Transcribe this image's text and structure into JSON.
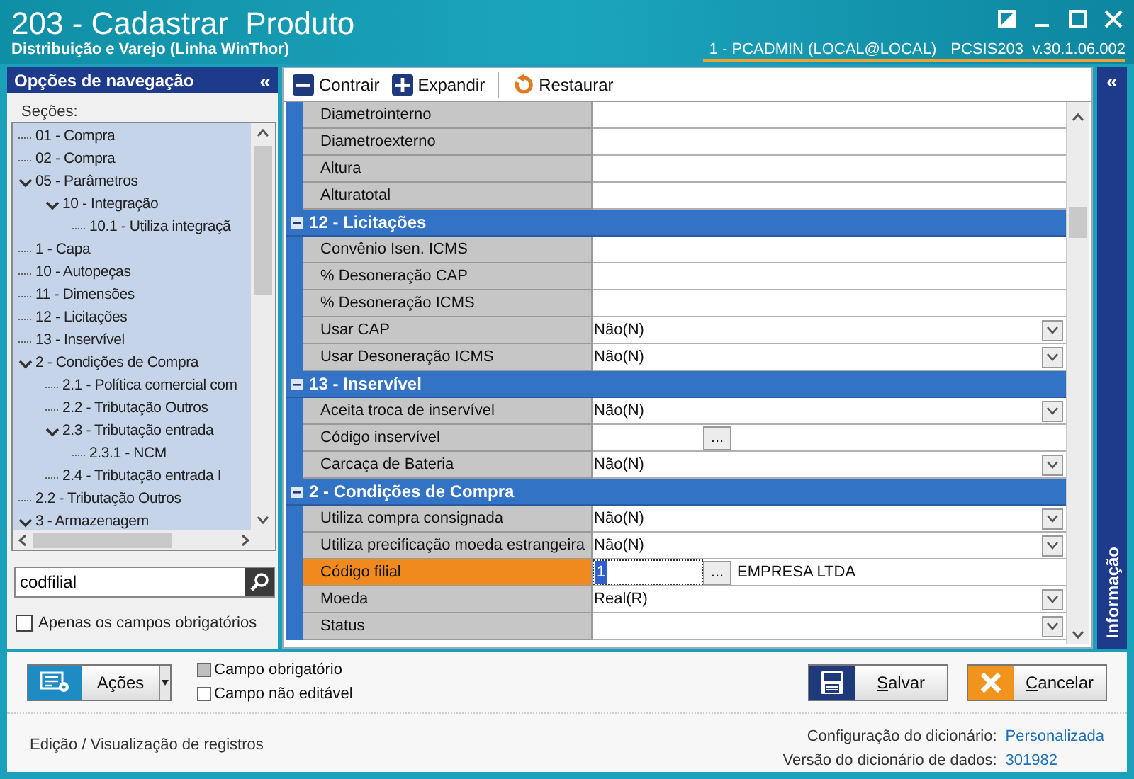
{
  "window": {
    "title": "203 - Cadastrar  Produto",
    "subtitle": "Distribuição e Varejo (Linha WinThor)",
    "user": "1 - PCADMIN (LOCAL@LOCAL)",
    "version": "PCSIS203  v.30.1.06.002"
  },
  "navigation": {
    "title": "Opções de navegação",
    "collapse": "«",
    "sections_label": "Seções:",
    "tree": [
      {
        "label": "01 - Compra"
      },
      {
        "label": "02 - Compra"
      },
      {
        "label": "05 - Parâmetros",
        "expanded": true,
        "children": [
          {
            "label": "10 - Integração",
            "expanded": true,
            "children": [
              {
                "label": "10.1 - Utiliza integraçã"
              }
            ]
          }
        ]
      },
      {
        "label": "1 - Capa"
      },
      {
        "label": "10 - Autopeças"
      },
      {
        "label": "11 - Dimensões"
      },
      {
        "label": "12 - Licitações"
      },
      {
        "label": "13 - Inservível"
      },
      {
        "label": "2 - Condições de Compra",
        "expanded": true,
        "children": [
          {
            "label": "2.1 - Política comercial com"
          },
          {
            "label": "2.2 - Tributação Outros"
          },
          {
            "label": "2.3 - Tributação entrada",
            "expanded": true,
            "children": [
              {
                "label": "2.3.1 - NCM"
              }
            ]
          },
          {
            "label": "2.4 - Tributação entrada I"
          }
        ]
      },
      {
        "label": "2.2 - Tributação Outros"
      },
      {
        "label": "3 - Armazenagem",
        "expanded": true
      }
    ],
    "search": {
      "value": "codfilial"
    },
    "only_required": {
      "label": "Apenas os campos obrigatórios",
      "checked": false
    }
  },
  "toolbar": [
    {
      "kind": "collapse",
      "label": "Contrair"
    },
    {
      "kind": "expand",
      "label": "Expandir"
    },
    {
      "kind": "restore",
      "label": "Restaurar"
    }
  ],
  "grid": {
    "rows": [
      {
        "kind": "text",
        "label": "Diametrointerno",
        "selected": false
      },
      {
        "kind": "text",
        "label": "Diametroexterno",
        "selected": false
      },
      {
        "kind": "text",
        "label": "Altura",
        "selected": false
      },
      {
        "kind": "text",
        "label": "Alturatotal",
        "selected": false
      },
      {
        "kind": "header",
        "label": "12 - Licitações",
        "expanded": true
      },
      {
        "kind": "text",
        "label": "Convênio Isen. ICMS",
        "selected": false
      },
      {
        "kind": "text",
        "label": "% Desoneração CAP",
        "selected": false
      },
      {
        "kind": "text",
        "label": "% Desoneração ICMS",
        "selected": false
      },
      {
        "kind": "dropdown",
        "label": "Usar CAP",
        "value": "Não(N)",
        "selected": false
      },
      {
        "kind": "dropdown",
        "label": "Usar Desoneração ICMS",
        "value": "Não(N)",
        "selected": false
      },
      {
        "kind": "header",
        "label": "13 - Inservível",
        "expanded": true
      },
      {
        "kind": "dropdown",
        "label": "Aceita troca de inservível",
        "value": "Não(N)",
        "selected": false
      },
      {
        "kind": "lookup",
        "label": "Código inservível",
        "browse_label": "...",
        "selected": false
      },
      {
        "kind": "dropdown",
        "label": "Carcaça de Bateria",
        "value": "Não(N)",
        "selected": false
      },
      {
        "kind": "header",
        "label": "2 - Condições de Compra",
        "expanded": true
      },
      {
        "kind": "dropdown",
        "label": "Utiliza compra consignada",
        "value": "Não(N)",
        "selected": false
      },
      {
        "kind": "dropdown",
        "label": "Utiliza precificação moeda estrangeira",
        "value": "Não(N)",
        "selected": false
      },
      {
        "kind": "lookup",
        "label": "Código filial",
        "value": "1",
        "browse_label": "...",
        "description": "EMPRESA LTDA",
        "selected": true
      },
      {
        "kind": "dropdown",
        "label": "Moeda",
        "value": "Real(R)",
        "selected": false
      },
      {
        "kind": "dropdown",
        "label": "Status",
        "selected": false
      }
    ]
  },
  "info_panel": {
    "collapse": "«",
    "title": "Informação"
  },
  "actions_button": {
    "label": "Ações"
  },
  "legend": [
    {
      "label": "Campo obrigatório",
      "color": "#c0c0c0"
    },
    {
      "label": "Campo não editável",
      "color": "#ffffff"
    }
  ],
  "buttons": [
    {
      "kind": "save",
      "label": "Salvar"
    },
    {
      "kind": "cancel",
      "label": "Cancelar"
    }
  ],
  "status_bar": {
    "mode": "Edição / Visualização de registros",
    "config_label": "Configuração do dicionário:",
    "config_value": "Personalizada",
    "version_label": "Versão do dicionário de dados:",
    "version_value": "301982"
  }
}
